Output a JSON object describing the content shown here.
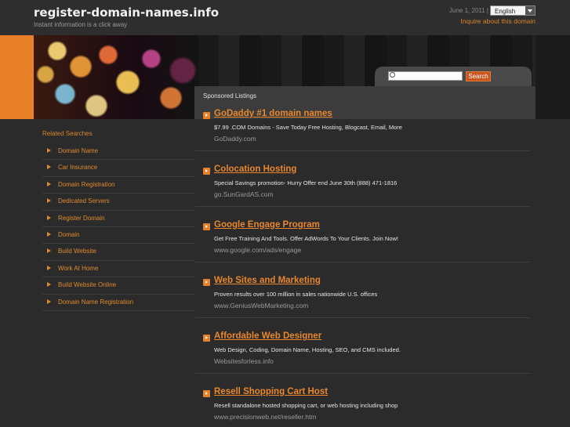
{
  "header": {
    "site_title": "register-domain-names.info",
    "tagline": "Instant information is a click away",
    "date": "June 1, 2011 |",
    "language": "English",
    "inquire": "Inquire about this domain"
  },
  "search": {
    "button_label": "Search",
    "value": ""
  },
  "sponsored": {
    "label": "Sponsored Listings",
    "listings": [
      {
        "title": "GoDaddy #1 domain names",
        "desc": "$7.99 .COM Domains - Save Today Free Hosting, Blogcast, Email, More",
        "url": "GoDaddy.com"
      },
      {
        "title": "Colocation Hosting",
        "desc": "Special Savings promotion- Hurry Offer end June 30th (888) 471-1816",
        "url": "go.SunGardAS.com"
      },
      {
        "title": "Google Engage Program",
        "desc": "Get Free Training And Tools. Offer AdWords To Your Clients. Join Now!",
        "url": "www.google.com/ads/engage"
      },
      {
        "title": "Web Sites and Marketing",
        "desc": "Proven results over 100 million in sales nationwide U.S. offices",
        "url": "www.GeniusWebMarketing.com"
      },
      {
        "title": "Affordable Web Designer",
        "desc": "Web Design, Coding, Domain Name, Hosting, SEO, and CMS included.",
        "url": "Websitesforless.info"
      },
      {
        "title": "Resell Shopping Cart Host",
        "desc": "Resell standalone hosted shopping cart, or web hosting including shop",
        "url": "www.precisionweb.net/reseller.htm"
      }
    ]
  },
  "related": {
    "title": "Related Searches",
    "items": [
      "Domain Name",
      "Car Insurance",
      "Domain Registration",
      "Dedicated Servers",
      "Register Domain",
      "Domain",
      "Build Website",
      "Work At Home",
      "Build Website Online",
      "Domain Name Registration"
    ]
  },
  "colors": {
    "accent": "#e8802a",
    "background": "#2b2b2b"
  }
}
